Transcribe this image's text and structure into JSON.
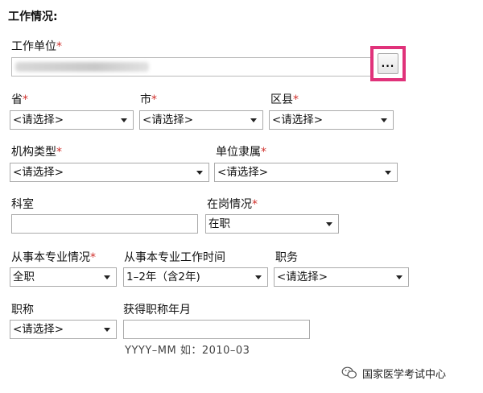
{
  "section": {
    "title": "工作情况:"
  },
  "work_unit": {
    "label": "工作单位",
    "required_mark": "*",
    "browse_label": "..."
  },
  "province": {
    "label": "省",
    "required_mark": "*",
    "value": "<请选择>"
  },
  "city": {
    "label": "市",
    "required_mark": "*",
    "value": "<请选择>"
  },
  "county": {
    "label": "区县",
    "required_mark": "*",
    "value": "<请选择>"
  },
  "org_type": {
    "label": "机构类型",
    "required_mark": "*",
    "value": "<请选择>"
  },
  "unit_affiliation": {
    "label": "单位隶属",
    "required_mark": "*",
    "value": "<请选择>"
  },
  "department": {
    "label": "科室",
    "value": ""
  },
  "post_status": {
    "label": "在岗情况",
    "required_mark": "*",
    "value": "在职"
  },
  "specialty_status": {
    "label": "从事本专业情况",
    "required_mark": "*",
    "value": "全职"
  },
  "specialty_years": {
    "label": "从事本专业工作时间",
    "value": "1–2年（含2年)"
  },
  "position": {
    "label": "职务",
    "value": "<请选择>"
  },
  "title": {
    "label": "职称",
    "value": "<请选择>"
  },
  "title_date": {
    "label": "获得职称年月",
    "value": "",
    "hint": "YYYY–MM 如：2010–03"
  },
  "watermark": {
    "text": "国家医学考试中心",
    "icon": "wechat-icon"
  }
}
